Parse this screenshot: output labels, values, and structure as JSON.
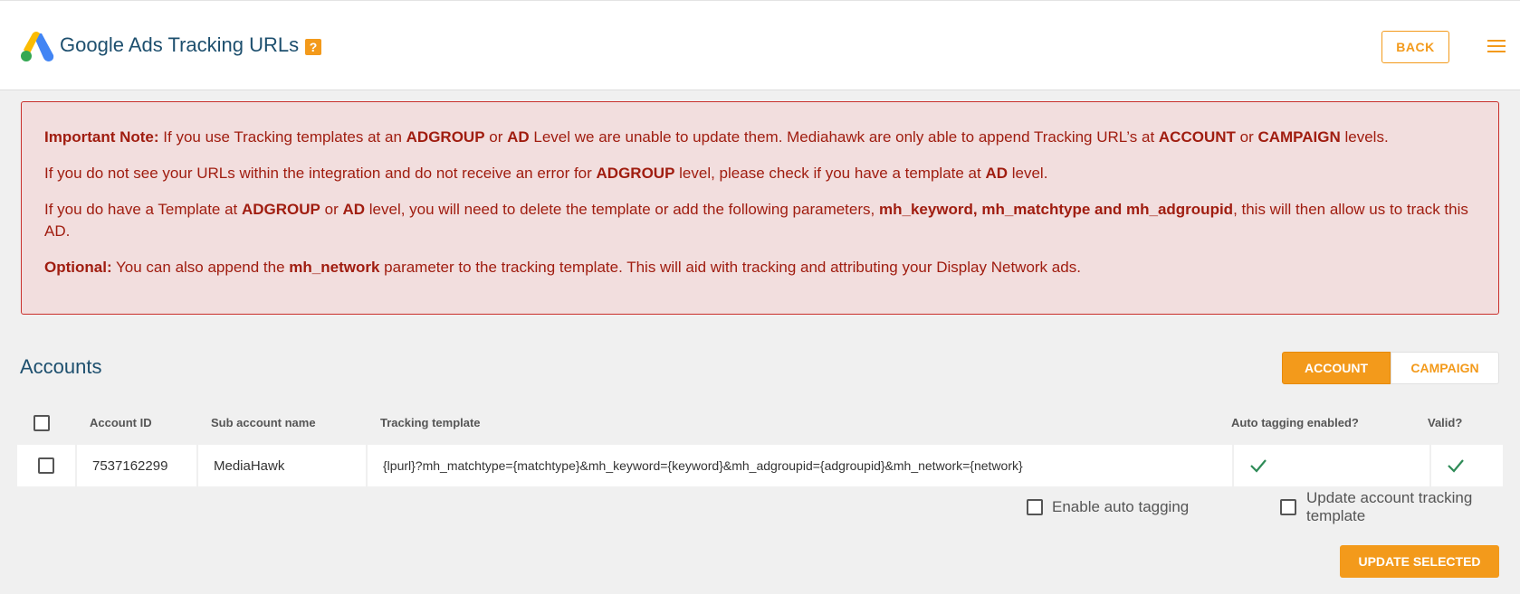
{
  "header": {
    "title": "Google Ads Tracking URLs",
    "help_badge": "?",
    "back_label": "BACK"
  },
  "note": {
    "line1": {
      "t0": "Important Note:",
      "t1": " If you use Tracking templates at an ",
      "t2": "ADGROUP",
      "t3": " or ",
      "t4": "AD",
      "t5": " Level we are unable to update them. Mediahawk are only able to append Tracking URL’s at ",
      "t6": "ACCOUNT",
      "t7": " or ",
      "t8": "CAMPAIGN",
      "t9": " levels."
    },
    "line2": {
      "t0": "If you do not see your URLs within the integration and do not receive an error for ",
      "t1": "ADGROUP",
      "t2": " level, please check if you have a template at ",
      "t3": "AD",
      "t4": " level."
    },
    "line3": {
      "t0": "If you do have a Template at ",
      "t1": "ADGROUP",
      "t2": " or ",
      "t3": "AD",
      "t4": " level, you will need to delete the template or add the following parameters, ",
      "t5": "mh_keyword, mh_matchtype and mh_adgroupid",
      "t6": ", this will then allow us to track this AD."
    },
    "line4": {
      "t0": "Optional:",
      "t1": " You can also append the ",
      "t2": "mh_network",
      "t3": " parameter to the tracking template. This will aid with tracking and attributing your Display Network ads."
    }
  },
  "accounts": {
    "title": "Accounts",
    "tab_account": "ACCOUNT",
    "tab_campaign": "CAMPAIGN",
    "columns": [
      "Account ID",
      "Sub account name",
      "Tracking template",
      "Auto tagging enabled?",
      "Valid?"
    ],
    "rows": [
      {
        "account_id": "7537162299",
        "sub_account_name": "MediaHawk",
        "tracking_template": "{lpurl}?mh_matchtype={matchtype}&mh_keyword={keyword}&mh_adgroupid={adgroupid}&mh_network={network}",
        "auto_tagging_enabled": true,
        "valid": true
      }
    ],
    "enable_auto_tagging_label": "Enable auto tagging",
    "update_template_label": "Update account tracking template",
    "update_selected_label": "UPDATE SELECTED"
  },
  "colors": {
    "accent": "#f39a1b",
    "title": "#1d4f6e",
    "alert_text": "#a01d10",
    "alert_bg": "#f2dede",
    "check": "#2e8b57"
  }
}
